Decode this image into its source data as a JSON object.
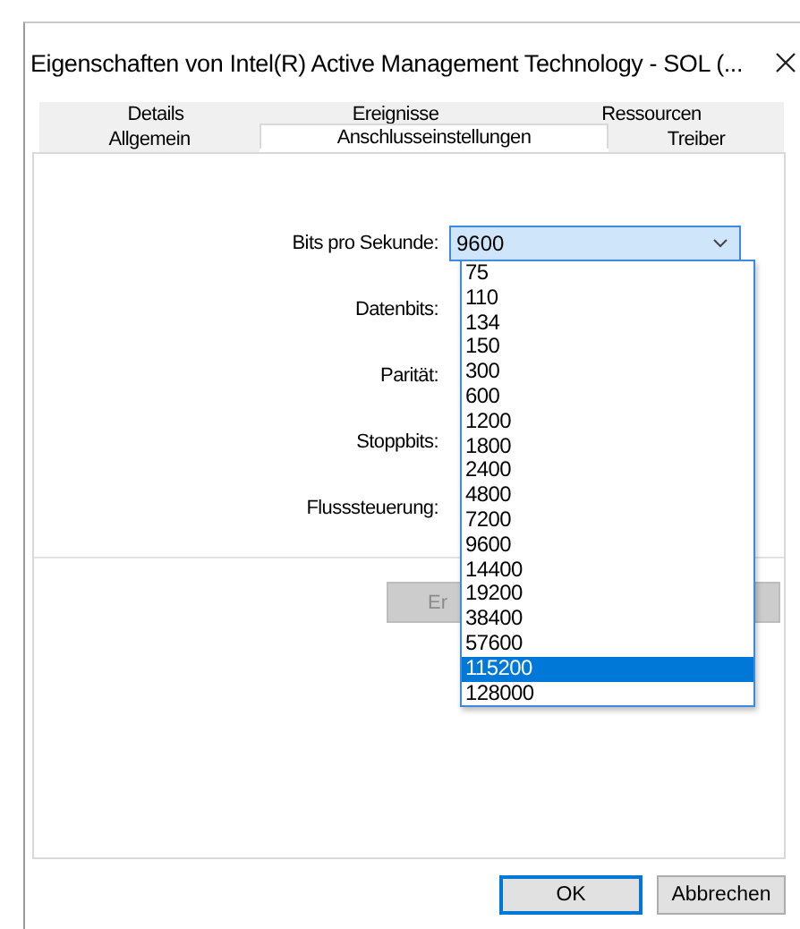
{
  "window": {
    "title": "Eigenschaften von Intel(R) Active Management Technology - SOL (..."
  },
  "tab_rows": [
    {
      "tabs": [
        {
          "label": "Details",
          "selected": false
        },
        {
          "label": "Ereignisse",
          "selected": false
        },
        {
          "label": "Ressourcen",
          "selected": false
        }
      ]
    },
    {
      "tabs": [
        {
          "label": "Allgemein",
          "selected": false
        },
        {
          "label": "Anschlusseinstellungen",
          "selected": true
        },
        {
          "label": "Treiber",
          "selected": false
        }
      ]
    }
  ],
  "fields": [
    {
      "label": "Bits pro Sekunde:",
      "kind": "combo",
      "value": "9600"
    },
    {
      "label": "Datenbits:",
      "kind": "label"
    },
    {
      "label": "Parität:",
      "kind": "label"
    },
    {
      "label": "Stoppbits:",
      "kind": "label"
    },
    {
      "label": "Flusssteuerung:",
      "kind": "label"
    }
  ],
  "dropdown": {
    "items": [
      {
        "text": "75",
        "selected": false
      },
      {
        "text": "110",
        "selected": false
      },
      {
        "text": "134",
        "selected": false
      },
      {
        "text": "150",
        "selected": false
      },
      {
        "text": "300",
        "selected": false
      },
      {
        "text": "600",
        "selected": false
      },
      {
        "text": "1200",
        "selected": false
      },
      {
        "text": "1800",
        "selected": false
      },
      {
        "text": "2400",
        "selected": false
      },
      {
        "text": "4800",
        "selected": false
      },
      {
        "text": "7200",
        "selected": false
      },
      {
        "text": "9600",
        "selected": false
      },
      {
        "text": "14400",
        "selected": false
      },
      {
        "text": "19200",
        "selected": false
      },
      {
        "text": "38400",
        "selected": false
      },
      {
        "text": "57600",
        "selected": false
      },
      {
        "text": "115200",
        "selected": true
      },
      {
        "text": "128000",
        "selected": false
      }
    ]
  },
  "panel_button": {
    "label": "Er",
    "disabled": true
  },
  "footer_buttons": [
    {
      "label": "OK",
      "default": true
    },
    {
      "label": "Abbrechen",
      "default": false
    }
  ]
}
